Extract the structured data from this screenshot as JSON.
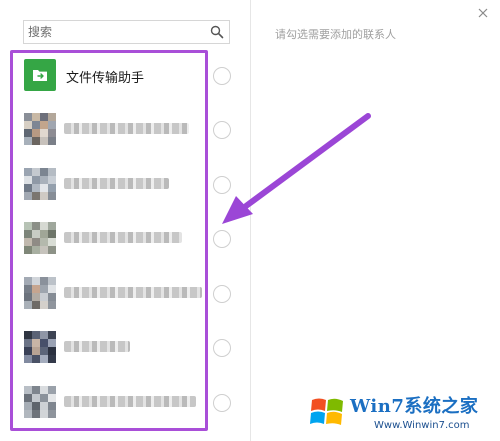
{
  "search": {
    "placeholder": "搜索"
  },
  "right_panel": {
    "hint": "请勾选需要添加的联系人"
  },
  "contacts": [
    {
      "name": "文件传输助手",
      "type": "file-helper"
    },
    {
      "name": "",
      "type": "blurred",
      "name_width": 125
    },
    {
      "name": "",
      "type": "blurred",
      "name_width": 105
    },
    {
      "name": "",
      "type": "blurred",
      "name_width": 118
    },
    {
      "name": "",
      "type": "blurred",
      "name_width": 138
    },
    {
      "name": "",
      "type": "blurred",
      "name_width": 66
    },
    {
      "name": "",
      "type": "blurred",
      "name_width": 132
    }
  ],
  "watermark": {
    "title": "Win7系统之家",
    "url": "Www.Winwin7.com"
  },
  "colors": {
    "accent_green": "#35a645",
    "highlight_purple": "#a94fd8",
    "arrow_purple": "#9b46d6"
  },
  "icons": [
    "search-icon",
    "close-icon",
    "folder-icon",
    "radio-button",
    "arrow-annotation",
    "windows-logo"
  ]
}
